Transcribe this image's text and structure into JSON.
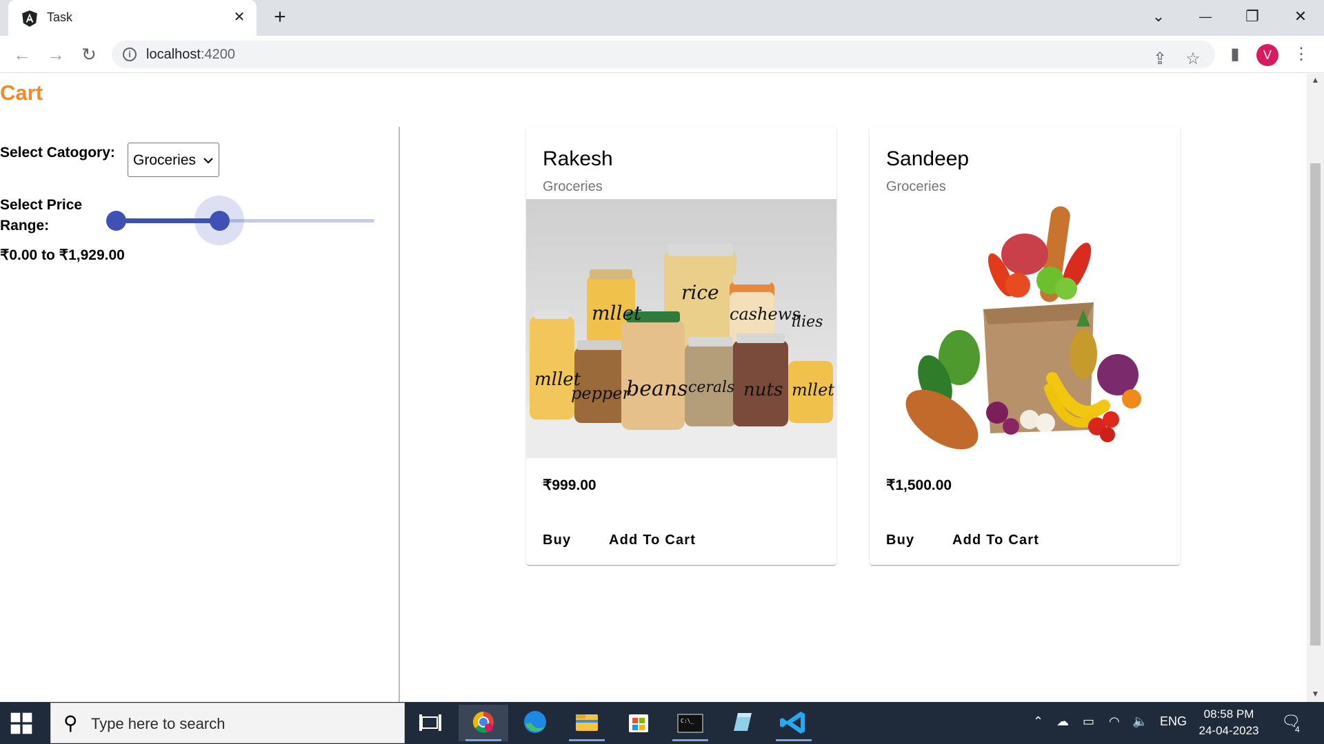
{
  "browser": {
    "tab_title": "Task",
    "tab_close": "✕",
    "new_tab": "+",
    "url_host": "localhost",
    "url_port": ":4200",
    "window_controls": {
      "dropdown": "⌄",
      "minimize": "—",
      "restore": "❐",
      "close": "✕"
    },
    "profile_initial": "V"
  },
  "page": {
    "title": "Cart",
    "filters": {
      "category_label": "Select Catogory:",
      "category_value": "Groceries",
      "price_label": "Select Price Range:",
      "price_range_text": "₹0.00 to ₹1,929.00",
      "slider_min_fraction": 0.0,
      "slider_max_fraction": 0.4
    },
    "products": [
      {
        "name": "Rakesh",
        "category": "Groceries",
        "price": "₹999.00",
        "buy_label": "Buy",
        "cart_label": "Add To Cart",
        "image": "jars-of-grains"
      },
      {
        "name": "Sandeep",
        "category": "Groceries",
        "price": "₹1,500.00",
        "buy_label": "Buy",
        "cart_label": "Add To Cart",
        "image": "grocery-bag"
      }
    ]
  },
  "taskbar": {
    "search_placeholder": "Type here to search",
    "language": "ENG",
    "time": "08:58 PM",
    "date": "24-04-2023",
    "notification_count": "4"
  },
  "colors": {
    "accent": "#3f51b5",
    "title": "#f08b2c"
  }
}
